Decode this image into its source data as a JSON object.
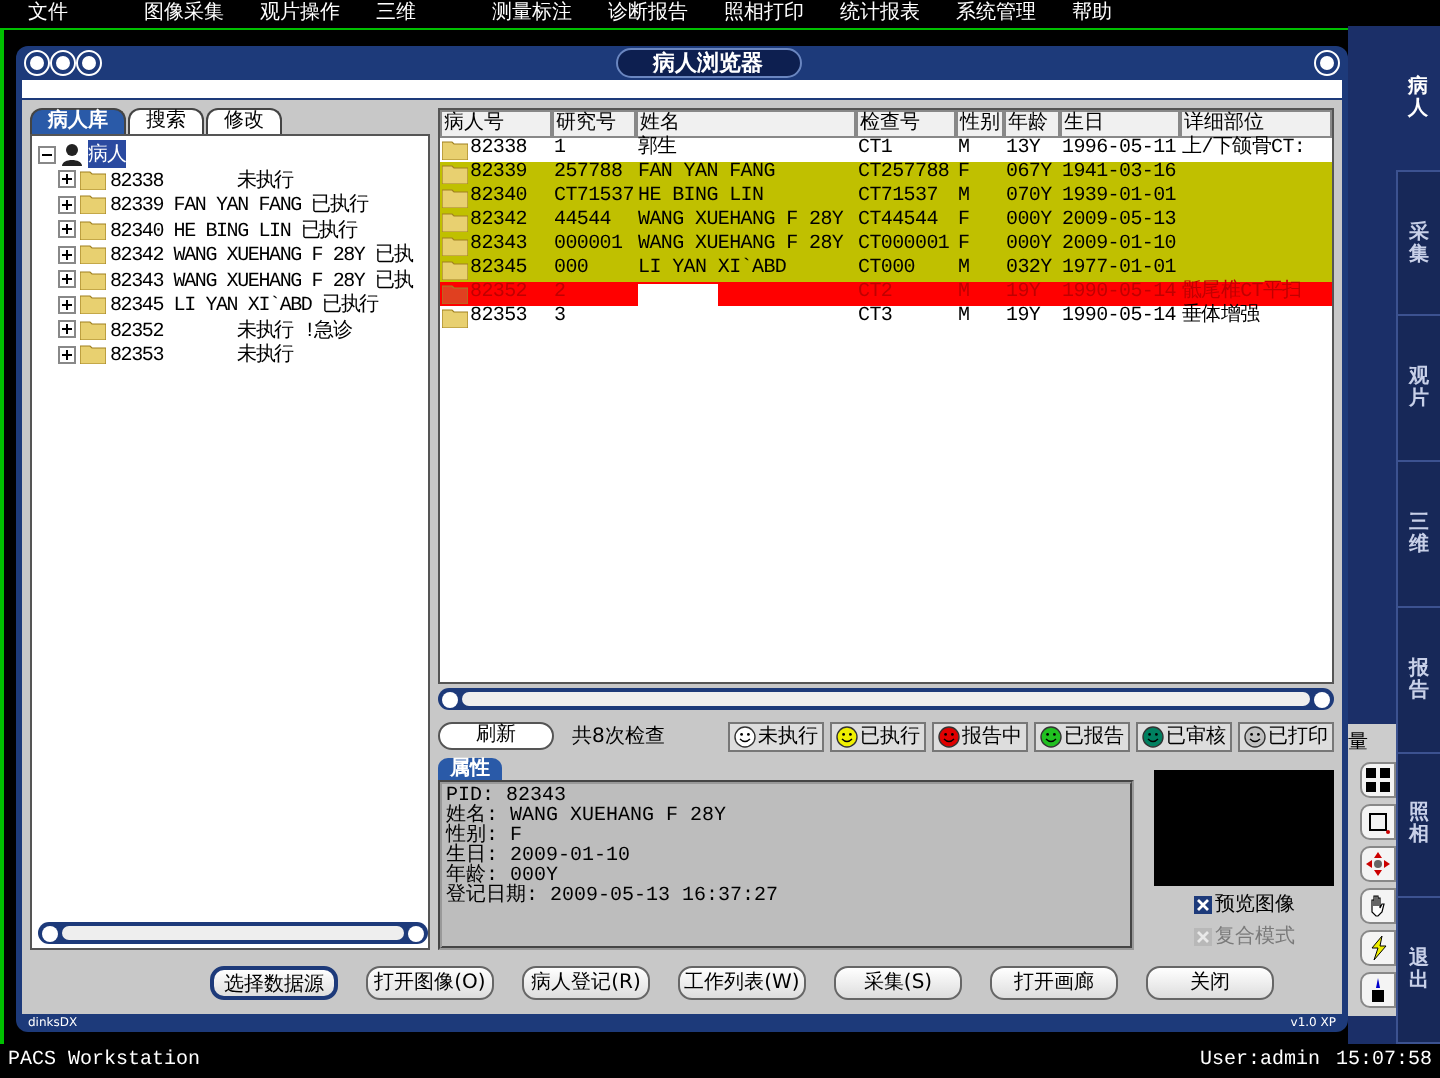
{
  "menu": [
    "文件",
    "图像采集",
    "观片操作",
    "三维",
    "测量标注",
    "诊断报告",
    "照相打印",
    "统计报表",
    "系统管理",
    "帮助"
  ],
  "dialog": {
    "title": "病人浏览器",
    "footer_left": "dinksDX",
    "footer_right": "v1.0 XP"
  },
  "left_tabs": [
    {
      "label": "病人库",
      "selected": true
    },
    {
      "label": "搜索",
      "selected": false
    },
    {
      "label": "修改",
      "selected": false
    }
  ],
  "tree": {
    "label": "病人",
    "selected": true,
    "expanded": true,
    "children": [
      {
        "label": "82338       未执行"
      },
      {
        "label": "82339 FAN YAN FANG 已执行"
      },
      {
        "label": "82340 HE BING LIN 已执行"
      },
      {
        "label": "82342 WANG XUEHANG F 28Y 已执"
      },
      {
        "label": "82343 WANG XUEHANG F 28Y 已执"
      },
      {
        "label": "82345 LI YAN XI`ABD 已执行"
      },
      {
        "label": "82352       未执行 !急诊"
      },
      {
        "label": "82353       未执行"
      }
    ]
  },
  "table": {
    "columns": [
      "病人号",
      "研究号",
      "姓名",
      "检查号",
      "性别",
      "年龄",
      "生日",
      "详细部位"
    ],
    "rows": [
      {
        "cells": [
          "82338",
          "1",
          "郭生",
          "CT1",
          "M",
          "13Y",
          "1996-05-11",
          "上/下颌骨CT:"
        ],
        "color": "#ffffff",
        "urgent": false
      },
      {
        "cells": [
          "82339",
          "257788",
          "FAN YAN FANG",
          "CT257788",
          "F",
          "067Y",
          "1941-03-16",
          ""
        ],
        "color": "#c0c000",
        "urgent": false
      },
      {
        "cells": [
          "82340",
          "CT71537",
          "HE BING LIN",
          "CT71537",
          "M",
          "070Y",
          "1939-01-01",
          ""
        ],
        "color": "#c0c000",
        "urgent": false
      },
      {
        "cells": [
          "82342",
          "44544",
          "WANG XUEHANG F 28Y",
          "CT44544",
          "F",
          "000Y",
          "2009-05-13",
          ""
        ],
        "color": "#c0c000",
        "urgent": false
      },
      {
        "cells": [
          "82343",
          "000001",
          "WANG XUEHANG F 28Y",
          "CT000001",
          "F",
          "000Y",
          "2009-01-10",
          ""
        ],
        "color": "#c0c000",
        "urgent": false
      },
      {
        "cells": [
          "82345",
          "000",
          "LI YAN XI`ABD",
          "CT000",
          "M",
          "032Y",
          "1977-01-01",
          ""
        ],
        "color": "#c0c000",
        "urgent": false
      },
      {
        "cells": [
          "82352",
          "2",
          "",
          "CT2",
          "M",
          "19Y",
          "1990-05-14",
          "骶尾椎CT平扫"
        ],
        "color": "#ff0000",
        "urgent": true
      },
      {
        "cells": [
          "82353",
          "3",
          "",
          "CT3",
          "M",
          "19Y",
          "1990-05-14",
          "垂体增强"
        ],
        "color": "#ffffff",
        "urgent": false
      }
    ]
  },
  "refresh_button": "刷新",
  "exam_count": "共8次检查",
  "legend": [
    {
      "label": "未执行",
      "color": "#ffffff"
    },
    {
      "label": "已执行",
      "color": "#f0f000"
    },
    {
      "label": "报告中",
      "color": "#e00000"
    },
    {
      "label": "已报告",
      "color": "#20c020"
    },
    {
      "label": "已审核",
      "color": "#008060"
    },
    {
      "label": "已打印",
      "color": "#c0c0c0"
    }
  ],
  "attributes": {
    "tab": "属性",
    "lines": [
      "PID: 82343",
      "姓名: WANG XUEHANG F 28Y",
      "性别: F",
      "生日: 2009-01-10",
      "年龄: 000Y",
      "登记日期: 2009-05-13 16:37:27"
    ]
  },
  "options": [
    {
      "label": "预览图像",
      "checked": true,
      "disabled": false
    },
    {
      "label": "复合模式",
      "checked": true,
      "disabled": true
    }
  ],
  "buttons": [
    {
      "label": "选择数据源",
      "default": true
    },
    {
      "label": "打开图像(O)",
      "default": false
    },
    {
      "label": "病人登记(R)",
      "default": false
    },
    {
      "label": "工作列表(W)",
      "default": false
    },
    {
      "label": "采集(S)",
      "default": false
    },
    {
      "label": "打开画廊",
      "default": false
    },
    {
      "label": "关闭",
      "default": false
    }
  ],
  "tool_panel": {
    "title": "量"
  },
  "nav": [
    {
      "label": "病人",
      "selected": true
    },
    {
      "label": "采集",
      "selected": false
    },
    {
      "label": "观片",
      "selected": false
    },
    {
      "label": "三维",
      "selected": false
    },
    {
      "label": "报告",
      "selected": false
    },
    {
      "label": "照相",
      "selected": false
    },
    {
      "label": "退出",
      "selected": false
    }
  ],
  "status_bar": {
    "app": "PACS Workstation",
    "user": "User:admin",
    "time": "15:07:58"
  }
}
